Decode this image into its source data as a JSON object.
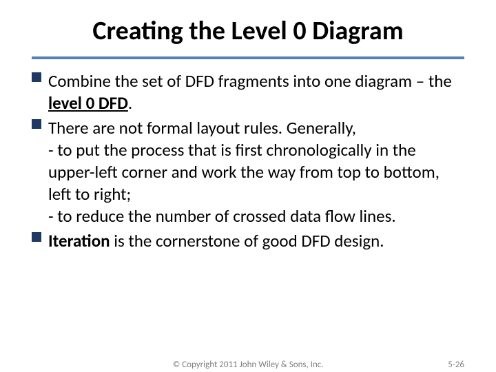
{
  "title": "Creating the Level 0 Diagram",
  "bullets": [
    {
      "pre": "Combine the set of DFD fragments into one diagram – the ",
      "emph": "level 0 DFD",
      "post": "."
    },
    {
      "pre": "There are not formal layout rules.  Generally,",
      "sublines": [
        "- to put the process that is first chronologically in the upper-left corner and work the way from top to bottom, left to right;",
        "- to reduce the number of crossed data flow lines."
      ]
    },
    {
      "emph2": "Iteration",
      "post": " is the cornerstone  of good DFD design."
    }
  ],
  "copyright": "© Copyright 2011 John Wiley & Sons, Inc.",
  "pagenum": "5-26"
}
